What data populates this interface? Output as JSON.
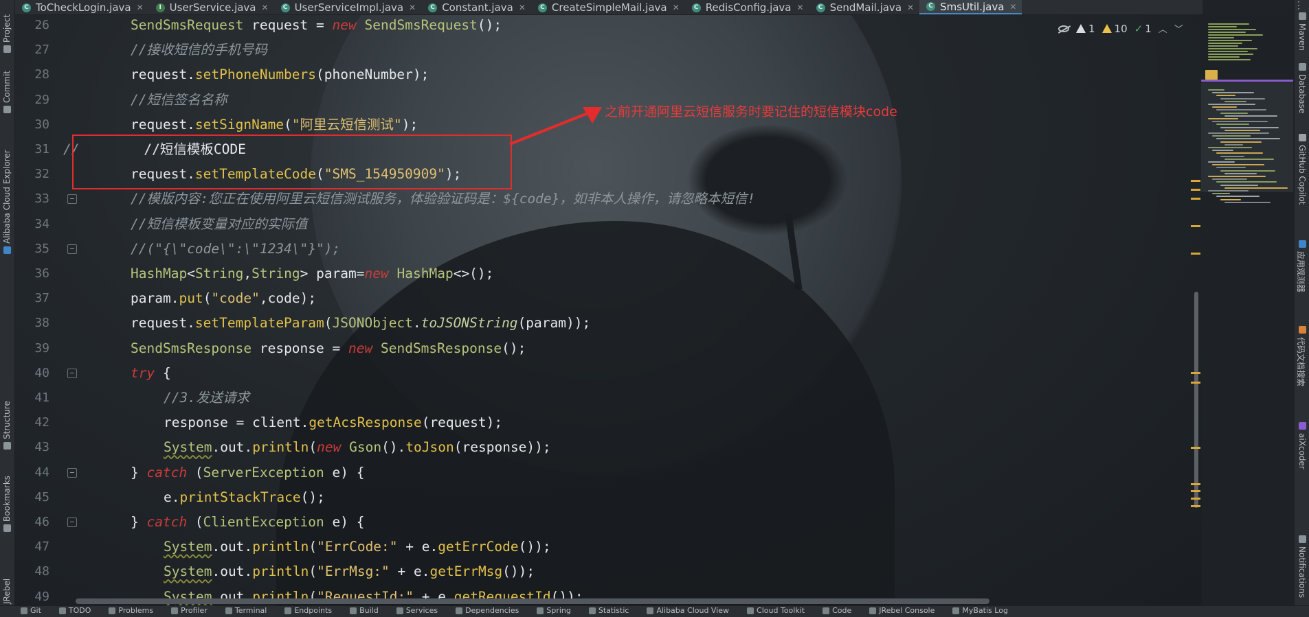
{
  "tabs": [
    {
      "label": "ToCheckLogin.java",
      "icon": "c",
      "active": false
    },
    {
      "label": "UserService.java",
      "icon": "i",
      "active": false
    },
    {
      "label": "UserServiceImpl.java",
      "icon": "c",
      "active": false
    },
    {
      "label": "Constant.java",
      "icon": "c",
      "active": false
    },
    {
      "label": "CreateSimpleMail.java",
      "icon": "c",
      "active": false
    },
    {
      "label": "RedisConfig.java",
      "icon": "c",
      "active": false
    },
    {
      "label": "SendMail.java",
      "icon": "c",
      "active": false
    },
    {
      "label": "SmsUtil.java",
      "icon": "c",
      "active": true
    }
  ],
  "tab_close_glyph": "✕",
  "tab_icon_letters": {
    "c": "C",
    "i": "I"
  },
  "more_tabs_glyph": "⋮",
  "left_tools": [
    "Project",
    "Commit",
    "Alibaba Cloud Explorer",
    "Structure",
    "Bookmarks",
    "JRebel"
  ],
  "right_tools": [
    "Maven",
    "Database",
    "GitHub Copilot",
    "应用观测器",
    "代码文档搜索",
    "aiXcoder",
    "Notifications"
  ],
  "inspections": {
    "errors": "1",
    "warnings": "10",
    "ok": "1"
  },
  "line_numbers": [
    "26",
    "27",
    "28",
    "29",
    "30",
    "31",
    "32",
    "33",
    "34",
    "35",
    "36",
    "37",
    "38",
    "39",
    "40",
    "41",
    "42",
    "43",
    "44",
    "45",
    "46",
    "47",
    "48",
    "49"
  ],
  "annotation": {
    "text": "之前开通阿里云短信服务时要记住的短信模块code",
    "color": "#e83a3a"
  },
  "code_tokens": {
    "l26": [
      "SendSmsRequest",
      " request = ",
      "new",
      " ",
      "SendSmsRequest",
      "();"
    ],
    "l27": [
      "//接收短信的手机号码"
    ],
    "l28": [
      "request.",
      "setPhoneNumbers",
      "(phoneNumber);"
    ],
    "l29": [
      "//短信签名名称"
    ],
    "l30": [
      "request.",
      "setSignName",
      "(",
      "\"阿里云短信测试\"",
      ");"
    ],
    "l31": [
      "//",
      "        //短信模板CODE"
    ],
    "l32": [
      "request.",
      "setTemplateCode",
      "(",
      "\"SMS_154950909\"",
      ");"
    ],
    "l33": [
      "//模版内容:您正在使用阿里云短信测试服务，体验验证码是：${code}，如非本人操作，请忽略本短信!"
    ],
    "l34": [
      "//短信模板变量对应的实际值"
    ],
    "l35": [
      "//(\"{\\\"code\\\":\\\"1234\\\"}\");"
    ],
    "l36": [
      "HashMap",
      "<",
      "String",
      ",",
      "String",
      "> param=",
      "new",
      " ",
      "HashMap",
      "<>",
      "();"
    ],
    "l37": [
      "param.",
      "put",
      "(",
      "\"code\"",
      ",code);"
    ],
    "l38": [
      "request.",
      "setTemplateParam",
      "(",
      "JSONObject",
      ".",
      "toJSONString",
      "(param));"
    ],
    "l39": [
      "SendSmsResponse",
      " response = ",
      "new",
      " ",
      "SendSmsResponse",
      "();"
    ],
    "l40": [
      "try",
      " {"
    ],
    "l41": [
      "//3.发送请求"
    ],
    "l42": [
      "response = client.",
      "getAcsResponse",
      "(request);"
    ],
    "l43": [
      "System",
      ".",
      "out",
      ".",
      "println",
      "(",
      "new",
      " ",
      "Gson",
      "().",
      "toJson",
      "(response));"
    ],
    "l44": [
      "} ",
      "catch",
      " (",
      "ServerException",
      " e) {"
    ],
    "l45": [
      "e.",
      "printStackTrace",
      "();"
    ],
    "l46": [
      "} ",
      "catch",
      " (",
      "ClientException",
      " e) {"
    ],
    "l47": [
      "System",
      ".",
      "out",
      ".",
      "println",
      "(",
      "\"ErrCode:\"",
      " + e.",
      "getErrCode",
      "());"
    ],
    "l48": [
      "System",
      ".",
      "out",
      ".",
      "println",
      "(",
      "\"ErrMsg:\"",
      " + e.",
      "getErrMsg",
      "());"
    ],
    "l49": [
      "System",
      ".",
      "out",
      ".",
      "println",
      "(",
      "\"RequestId:\"",
      " + e.",
      "getRequestId",
      "());"
    ]
  },
  "statusbar": [
    "Git",
    "TODO",
    "Problems",
    "Profiler",
    "Terminal",
    "Endpoints",
    "Build",
    "Services",
    "Dependencies",
    "Spring",
    "Statistic",
    "Alibaba Cloud View",
    "Cloud Toolkit",
    "Code",
    "JRebel Console",
    "MyBatis Log"
  ],
  "colors": {
    "keyword": "#cc3b3b",
    "type": "#b8c47a",
    "method": "#e2c14a",
    "string": "#e0c070",
    "comment": "#8d969c",
    "annotation_red": "#e52c2c"
  }
}
